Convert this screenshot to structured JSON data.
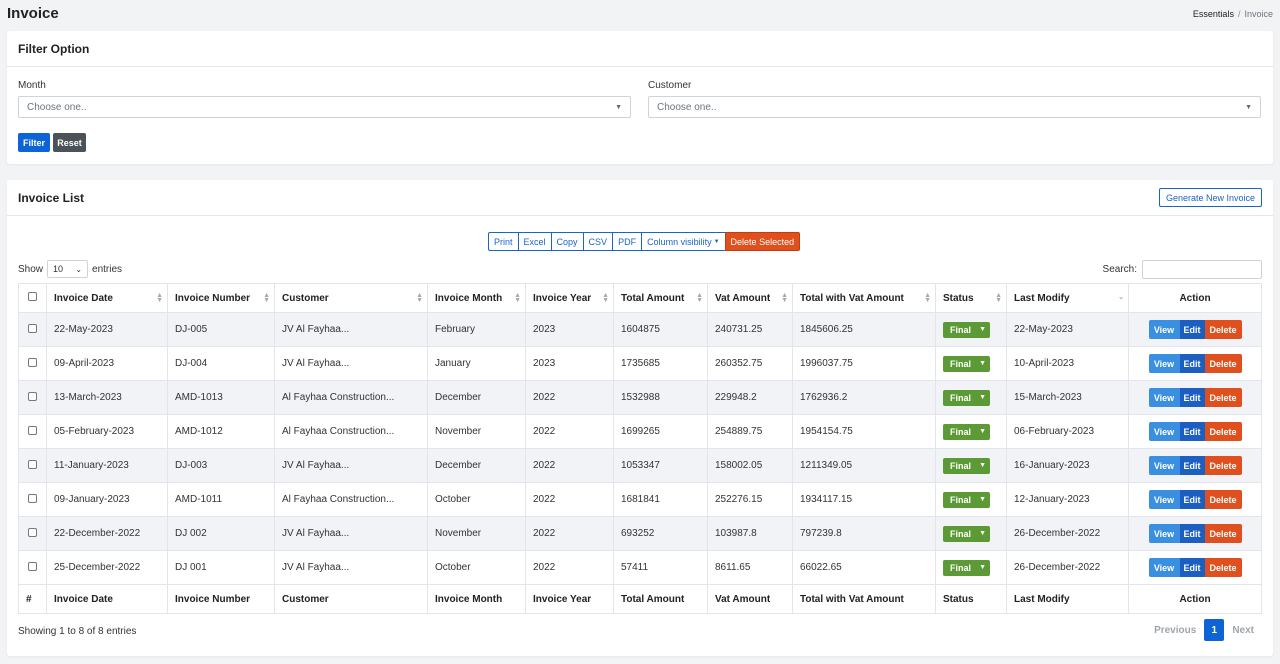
{
  "page": {
    "title": "Invoice"
  },
  "breadcrumb": {
    "parent": "Essentials",
    "separator": "/",
    "current": "Invoice"
  },
  "filter": {
    "title": "Filter Option",
    "month": {
      "label": "Month",
      "placeholder": "Choose one.."
    },
    "customer": {
      "label": "Customer",
      "placeholder": "Choose one.."
    },
    "filter_button": "Filter",
    "reset_button": "Reset"
  },
  "list": {
    "title": "Invoice List",
    "generate_button": "Generate New Invoice",
    "export_buttons": [
      "Print",
      "Excel",
      "Copy",
      "CSV",
      "PDF",
      "Column visibility"
    ],
    "delete_selected": "Delete Selected",
    "show_label": "Show",
    "entries_value": "10",
    "entries_label": "entries",
    "search_label": "Search:",
    "columns": [
      "Invoice Date",
      "Invoice Number",
      "Customer",
      "Invoice Month",
      "Invoice Year",
      "Total Amount",
      "Vat Amount",
      "Total with Vat Amount",
      "Status",
      "Last Modify",
      "Action"
    ],
    "footer_columns": [
      "#",
      "Invoice Date",
      "Invoice Number",
      "Customer",
      "Invoice Month",
      "Invoice Year",
      "Total Amount",
      "Vat Amount",
      "Total with Vat Amount",
      "Status",
      "Last Modify",
      "Action"
    ],
    "rows": [
      {
        "date": "22-May-2023",
        "number": "DJ-005",
        "customer": "JV Al Fayhaa...",
        "month": "February",
        "year": "2023",
        "total": "1604875",
        "vat": "240731.25",
        "total_vat": "1845606.25",
        "status": "Final",
        "modified": "22-May-2023"
      },
      {
        "date": "09-April-2023",
        "number": "DJ-004",
        "customer": "JV Al Fayhaa...",
        "month": "January",
        "year": "2023",
        "total": "1735685",
        "vat": "260352.75",
        "total_vat": "1996037.75",
        "status": "Final",
        "modified": "10-April-2023"
      },
      {
        "date": "13-March-2023",
        "number": "AMD-1013",
        "customer": "Al Fayhaa Construction...",
        "month": "December",
        "year": "2022",
        "total": "1532988",
        "vat": "229948.2",
        "total_vat": "1762936.2",
        "status": "Final",
        "modified": "15-March-2023"
      },
      {
        "date": "05-February-2023",
        "number": "AMD-1012",
        "customer": "Al Fayhaa Construction...",
        "month": "November",
        "year": "2022",
        "total": "1699265",
        "vat": "254889.75",
        "total_vat": "1954154.75",
        "status": "Final",
        "modified": "06-February-2023"
      },
      {
        "date": "11-January-2023",
        "number": "DJ-003",
        "customer": "JV Al Fayhaa...",
        "month": "December",
        "year": "2022",
        "total": "1053347",
        "vat": "158002.05",
        "total_vat": "1211349.05",
        "status": "Final",
        "modified": "16-January-2023"
      },
      {
        "date": "09-January-2023",
        "number": "AMD-1011",
        "customer": "Al Fayhaa Construction...",
        "month": "October",
        "year": "2022",
        "total": "1681841",
        "vat": "252276.15",
        "total_vat": "1934117.15",
        "status": "Final",
        "modified": "12-January-2023"
      },
      {
        "date": "22-December-2022",
        "number": "DJ 002",
        "customer": "JV Al Fayhaa...",
        "month": "November",
        "year": "2022",
        "total": "693252",
        "vat": "103987.8",
        "total_vat": "797239.8",
        "status": "Final",
        "modified": "26-December-2022"
      },
      {
        "date": "25-December-2022",
        "number": "DJ 001",
        "customer": "JV Al Fayhaa...",
        "month": "October",
        "year": "2022",
        "total": "57411",
        "vat": "8611.65",
        "total_vat": "66022.65",
        "status": "Final",
        "modified": "26-December-2022"
      }
    ],
    "actions": {
      "view": "View",
      "edit": "Edit",
      "delete": "Delete"
    },
    "info": "Showing 1 to 8 of 8 entries",
    "pagination": {
      "previous": "Previous",
      "current": "1",
      "next": "Next"
    }
  },
  "colors": {
    "primary": "#0d64d7",
    "danger": "#e0501e",
    "success": "#5b9a34",
    "dark": "#4b5258"
  }
}
